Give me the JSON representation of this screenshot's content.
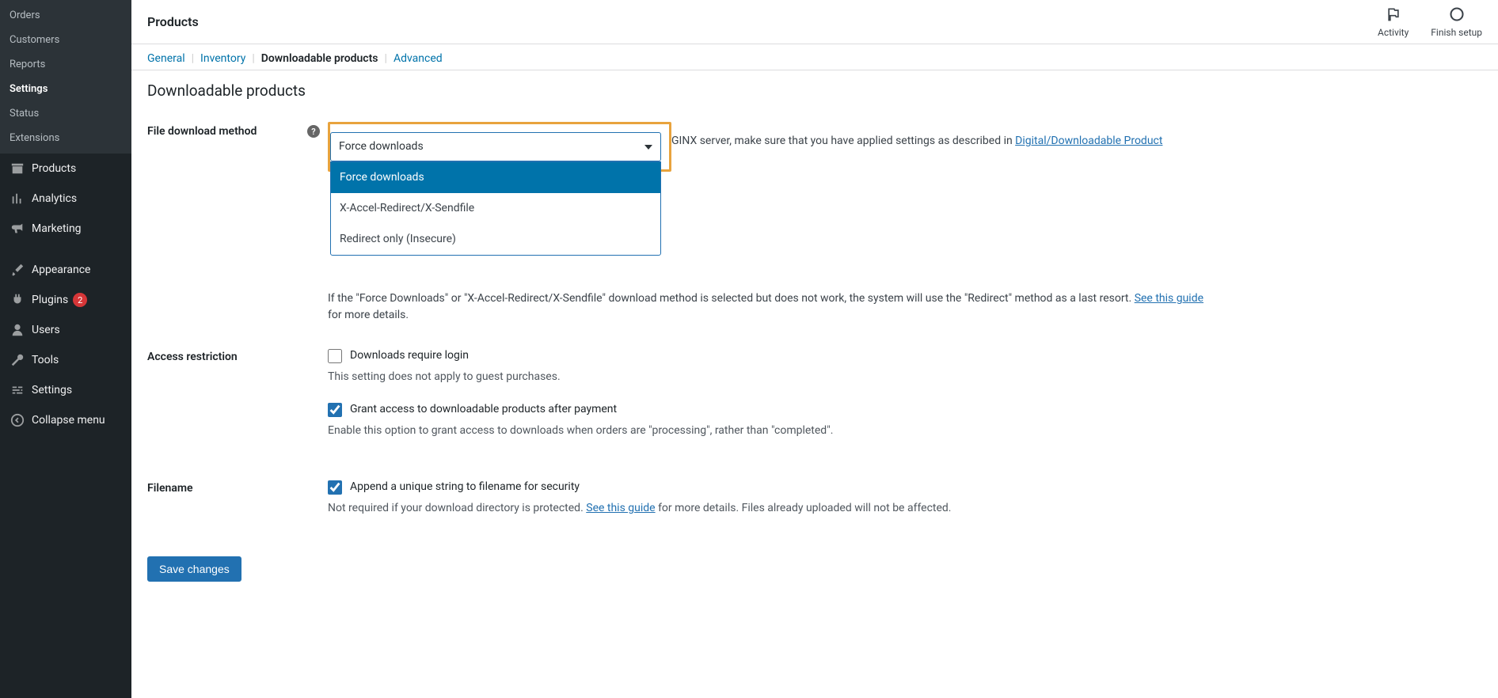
{
  "sidebar": {
    "sub_items": [
      {
        "label": "Orders",
        "active": false
      },
      {
        "label": "Customers",
        "active": false
      },
      {
        "label": "Reports",
        "active": false
      },
      {
        "label": "Settings",
        "active": true
      },
      {
        "label": "Status",
        "active": false
      },
      {
        "label": "Extensions",
        "active": false
      }
    ],
    "main_items": [
      {
        "label": "Products",
        "icon": "archive"
      },
      {
        "label": "Analytics",
        "icon": "chart"
      },
      {
        "label": "Marketing",
        "icon": "megaphone"
      }
    ],
    "admin_items": [
      {
        "label": "Appearance",
        "icon": "brush"
      },
      {
        "label": "Plugins",
        "icon": "plug",
        "badge": "2"
      },
      {
        "label": "Users",
        "icon": "user"
      },
      {
        "label": "Tools",
        "icon": "wrench"
      },
      {
        "label": "Settings",
        "icon": "sliders"
      }
    ],
    "collapse": "Collapse menu"
  },
  "topbar": {
    "title": "Products",
    "activity": "Activity",
    "finish": "Finish setup"
  },
  "tabs": [
    {
      "label": "General",
      "current": false
    },
    {
      "label": "Inventory",
      "current": false
    },
    {
      "label": "Downloadable products",
      "current": true
    },
    {
      "label": "Advanced",
      "current": false
    }
  ],
  "page": {
    "heading": "Downloadable products",
    "download_method_label": "File download method",
    "download_method_value": "Force downloads",
    "dropdown_options": [
      "Force downloads",
      "X-Accel-Redirect/X-Sendfile",
      "Redirect only (Insecure)"
    ],
    "nginx_note_pre": "GINX server, make sure that you have applied settings as described in ",
    "nginx_link": "Digital/Downloadable Product",
    "fallback_note": "If the \"Force Downloads\" or \"X-Accel-Redirect/X-Sendfile\" download method is selected but does not work, the system will use the \"Redirect\" method as a last resort. ",
    "fallback_link": "See this guide",
    "fallback_after": " for more details.",
    "access_label": "Access restriction",
    "access_check1": "Downloads require login",
    "access_desc1": "This setting does not apply to guest purchases.",
    "access_check2": "Grant access to downloadable products after payment",
    "access_desc2": "Enable this option to grant access to downloads when orders are \"processing\", rather than \"completed\".",
    "filename_label": "Filename",
    "filename_check": "Append a unique string to filename for security",
    "filename_desc_pre": "Not required if your download directory is protected. ",
    "filename_link": "See this guide",
    "filename_desc_post": " for more details. Files already uploaded will not be affected.",
    "save_button": "Save changes"
  }
}
